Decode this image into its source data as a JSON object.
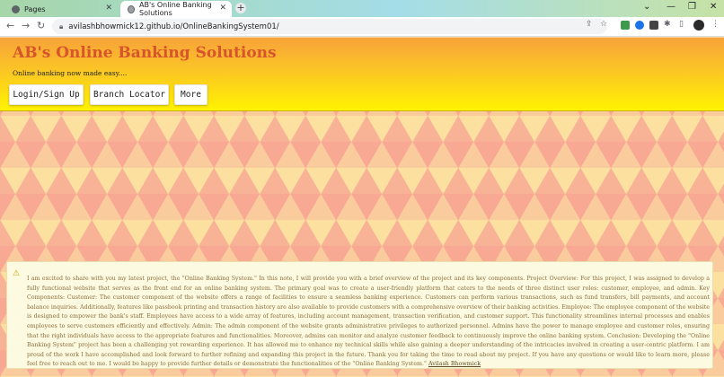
{
  "browser": {
    "tabs": [
      {
        "title": "Pages",
        "active": false
      },
      {
        "title": "AB's Online Banking Solutions",
        "active": true
      }
    ],
    "url": "avilashbhowmick12.github.io/OnlineBankingSystem01/",
    "icons": [
      "back-icon",
      "forward-icon",
      "reload-icon",
      "lock-icon",
      "share-icon",
      "star-icon",
      "extensions-icon",
      "sidebar-icon",
      "menu-icon"
    ]
  },
  "site": {
    "title": "AB's Online Banking Solutions",
    "tagline": "Online banking now made easy....",
    "nav": {
      "login": "Login/Sign Up",
      "branch": "Branch Locator",
      "more": "More"
    },
    "colors": {
      "title": "#d8542c",
      "banner_top": "#f7a23a",
      "banner_bottom": "#fff200"
    }
  },
  "notice": {
    "text": "I am excited to share with you my latest project, the \"Online Banking System.\" In this note, I will provide you with a brief overview of the project and its key components. Project Overview: For this project, I was assigned to develop a fully functional website that serves as the front end for an online banking system. The primary goal was to create a user-friendly platform that caters to the needs of three distinct user roles: customer, employee, and admin. Key Components: Customer: The customer component of the website offers a range of facilities to ensure a seamless banking experience. Customers can perform various transactions, such as fund transfers, bill payments, and account balance inquiries. Additionally, features like passbook printing and transaction history are also available to provide customers with a comprehensive overview of their banking activities. Employee: The employee component of the website is designed to empower the bank's staff. Employees have access to a wide array of features, including account management, transaction verification, and customer support. This functionality streamlines internal processes and enables employees to serve customers efficiently and effectively. Admin: The admin component of the website grants administrative privileges to authorized personnel. Admins have the power to manage employee and customer roles, ensuring that the right individuals have access to the appropriate features and functionalities. Moreover, admins can monitor and analyze customer feedback to continuously improve the online banking system. Conclusion: Developing the \"Online Banking System\" project has been a challenging yet rewarding experience. It has allowed me to enhance my technical skills while also gaining a deeper understanding of the intricacies involved in creating a user-centric platform. I am proud of the work I have accomplished and look forward to further refining and expanding this project in the future. Thank you for taking the time to read about my project. If you have any questions or would like to learn more, please feel free to reach out to me. I would be happy to provide further details or demonstrate the functionalities of the \"Online Banking System.\" ",
    "author": "Avilash Bhowmick"
  }
}
